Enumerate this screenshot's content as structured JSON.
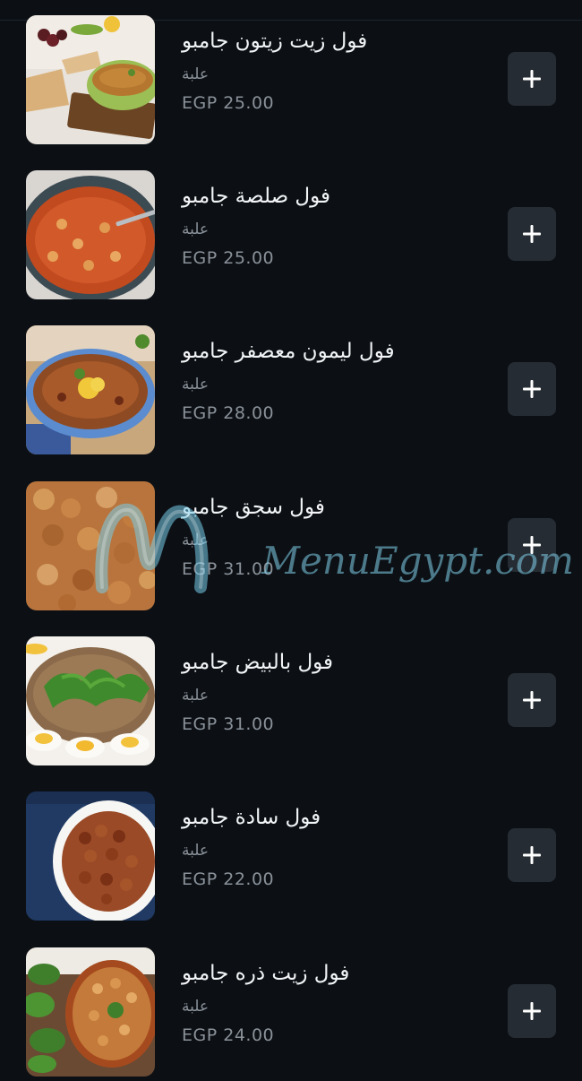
{
  "menu": {
    "items": [
      {
        "title": "فول زيت زيتون جامبو",
        "unit": "علبة",
        "price": "EGP 25.00",
        "add_icon": "plus-icon"
      },
      {
        "title": "فول صلصة جامبو",
        "unit": "علبة",
        "price": "EGP 25.00",
        "add_icon": "plus-icon"
      },
      {
        "title": "فول ليمون معصفر جامبو",
        "unit": "علبة",
        "price": "EGP 28.00",
        "add_icon": "plus-icon"
      },
      {
        "title": "فول سجق جامبو",
        "unit": "علبة",
        "price": "EGP 31.00",
        "add_icon": "plus-icon"
      },
      {
        "title": "فول بالبيض جامبو",
        "unit": "علبة",
        "price": "EGP 31.00",
        "add_icon": "plus-icon"
      },
      {
        "title": "فول سادة جامبو",
        "unit": "علبة",
        "price": "EGP 22.00",
        "add_icon": "plus-icon"
      },
      {
        "title": "فول زيت ذره جامبو",
        "unit": "علبة",
        "price": "EGP 24.00",
        "add_icon": "plus-icon"
      }
    ]
  },
  "watermark": {
    "text": "MenuEgypt.com"
  },
  "colors": {
    "background": "#0c1015",
    "button": "#262c33",
    "title": "#f2f4f6",
    "muted": "#8a9199"
  }
}
